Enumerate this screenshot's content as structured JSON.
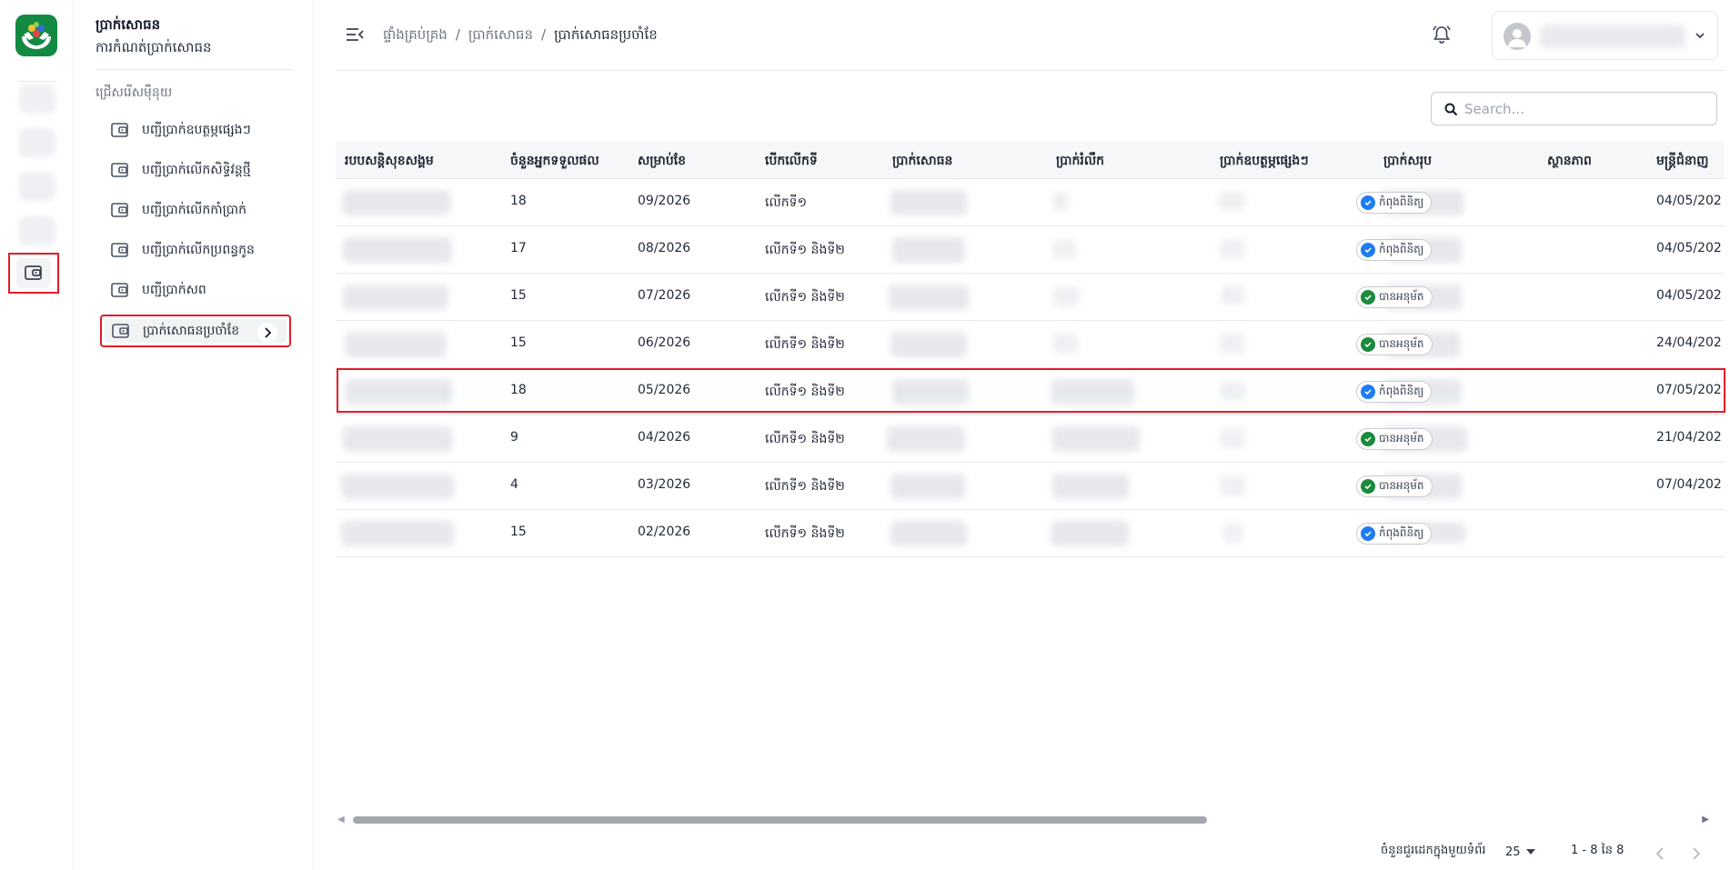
{
  "sidebar": {
    "title": "ប្រាក់សោធន",
    "subtitle": "ការកំណត់ប្រាក់សោធន",
    "section_label": "ជ្រើសរើសម៉ឺនុយ",
    "items": [
      {
        "label": "បញ្ជីប្រាក់ឧបត្ថម្ភផ្សេងៗ",
        "icon": "wallet-icon"
      },
      {
        "label": "បញ្ជីប្រាក់លើកសិទ្ធិវន្តថ្មី",
        "icon": "wallet-icon"
      },
      {
        "label": "បញ្ជីប្រាក់លើកកាំប្រាក់",
        "icon": "wallet-icon"
      },
      {
        "label": "បញ្ជីប្រាក់លើកប្រពន្ធកូន",
        "icon": "wallet-icon"
      },
      {
        "label": "បញ្ជីប្រាក់សព",
        "icon": "wallet-icon"
      },
      {
        "label": "ប្រាក់សោធនប្រចាំខែ",
        "icon": "wallet-icon",
        "active": true
      }
    ]
  },
  "header": {
    "breadcrumb": [
      "ផ្ទាំងគ្រប់គ្រង",
      "ប្រាក់សោធន",
      "ប្រាក់សោធនប្រចាំខែ"
    ],
    "separator": "/"
  },
  "search": {
    "placeholder": "Search..."
  },
  "table": {
    "columns": [
      "របបសន្តិសុខសង្គម",
      "ចំនួនអ្នកទទួលផល",
      "សម្រាប់ខែ",
      "បើកលើកទី",
      "ប្រាក់សោធន",
      "ប្រាក់រំលឹក",
      "ប្រាក់ឧបត្ថម្ភផ្សេងៗ",
      "ប្រាក់សរុប",
      "ស្ថានភាព",
      "មន្ត្រីជំនាញ"
    ],
    "rows": [
      {
        "count": "18",
        "month": "09/2026",
        "round": "លើកទី១",
        "status": "កំពុងពិនិត្យ",
        "status_type": "review",
        "date": "04/05/202"
      },
      {
        "count": "17",
        "month": "08/2026",
        "round": "លើកទី១ និងទី២",
        "status": "កំពុងពិនិត្យ",
        "status_type": "review",
        "date": "04/05/202"
      },
      {
        "count": "15",
        "month": "07/2026",
        "round": "លើកទី១ និងទី២",
        "status": "បានអនុម័ត",
        "status_type": "approved",
        "date": "04/05/202"
      },
      {
        "count": "15",
        "month": "06/2026",
        "round": "លើកទី១ និងទី២",
        "status": "បានអនុម័ត",
        "status_type": "approved",
        "date": "24/04/202"
      },
      {
        "count": "18",
        "month": "05/2026",
        "round": "លើកទី១ និងទី២",
        "status": "កំពុងពិនិត្យ",
        "status_type": "review",
        "date": "07/05/202"
      },
      {
        "count": "9",
        "month": "04/2026",
        "round": "លើកទី១ និងទី២",
        "status": "បានអនុម័ត",
        "status_type": "approved",
        "date": "21/04/202"
      },
      {
        "count": "4",
        "month": "03/2026",
        "round": "លើកទី១ និងទី២",
        "status": "បានអនុម័ត",
        "status_type": "approved",
        "date": "07/04/202"
      },
      {
        "count": "15",
        "month": "02/2026",
        "round": "លើកទី១ និងទី២",
        "status": "កំពុងពិនិត្យ",
        "status_type": "review",
        "date": ""
      }
    ]
  },
  "pagination": {
    "rows_per_page_label": "ចំនួនជួរដេកក្នុងមួយទំព័រ",
    "rows_per_page": "25",
    "range": "1 - 8 នៃ 8"
  },
  "colors": {
    "accent_green": "#138a42",
    "review_blue": "#1d7cf2",
    "approved_green": "#1a8a3c",
    "highlight_red": "#e11d2b"
  }
}
